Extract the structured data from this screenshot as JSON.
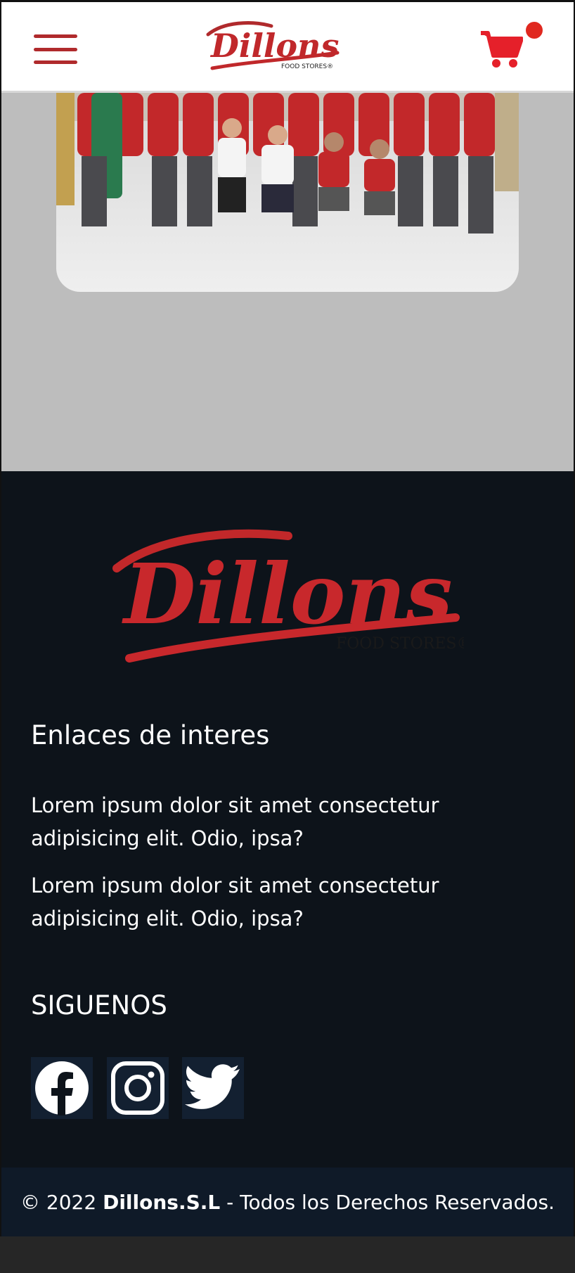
{
  "header": {
    "brand_name": "Dillons",
    "brand_tagline": "FOOD STORES®",
    "menu_icon": "hamburger-menu-icon",
    "cart_icon": "shopping-cart-icon",
    "colors": {
      "brand_red": "#b02a2c",
      "cart_red": "#e5202a",
      "badge": "#e0281f"
    }
  },
  "hero": {
    "image_desc": "store-team-photo",
    "background": "#bdbdbd"
  },
  "footer": {
    "logo_name": "Dillons",
    "logo_tagline": "FOOD STORES®",
    "links_title": "Enlaces de interes",
    "links": [
      "Lorem ipsum dolor sit amet consectetur adipisicing elit. Odio, ipsa?",
      "Lorem ipsum dolor sit amet consectetur adipisicing elit. Odio, ipsa?"
    ],
    "follow_title": "SIGUENOS",
    "social": [
      "facebook-icon",
      "instagram-icon",
      "twitter-icon"
    ],
    "background": "#0d131a"
  },
  "copyright": {
    "prefix": "© 2022",
    "company": "Dillons.S.L",
    "suffix": "- Todos los Derechos Reservados."
  }
}
